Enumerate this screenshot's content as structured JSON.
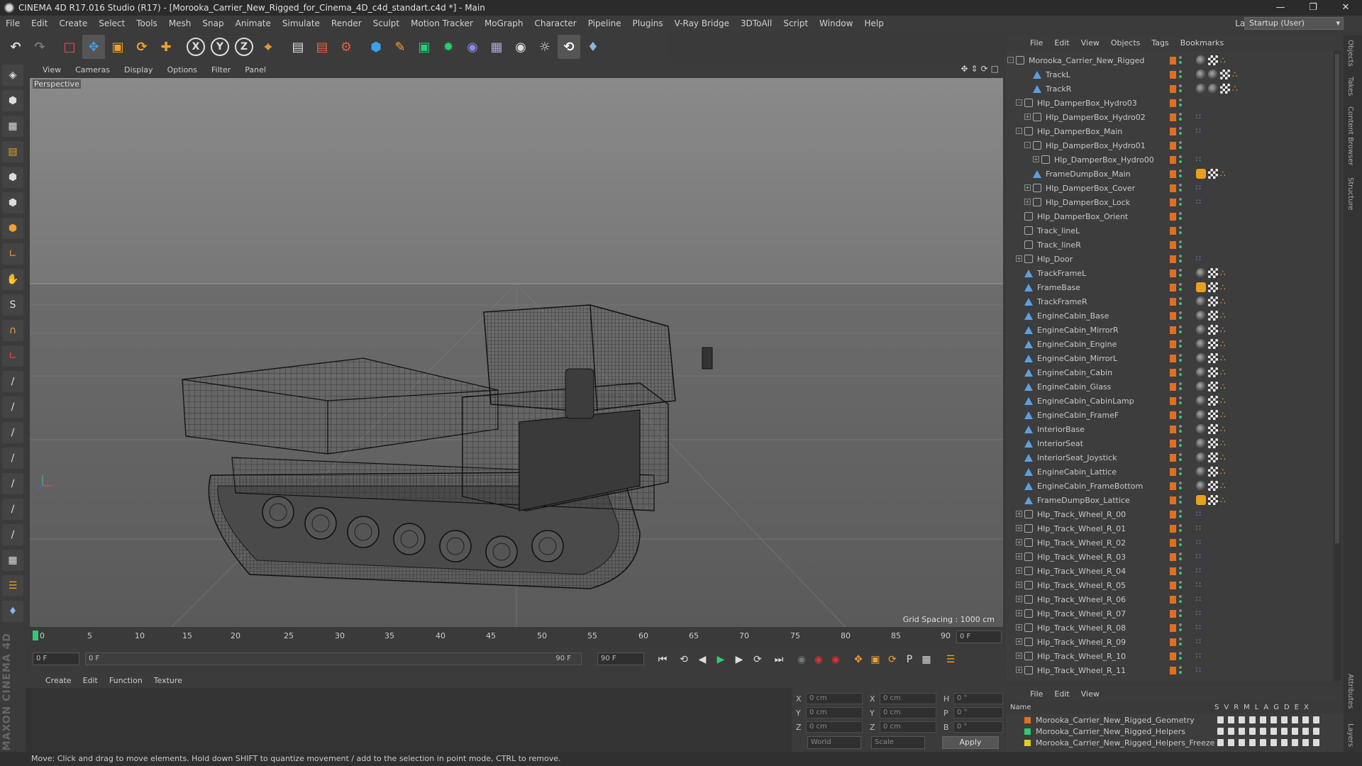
{
  "window": {
    "title": "CINEMA 4D R17.016 Studio (R17) - [Morooka_Carrier_New_Rigged_for_Cinema_4D_c4d_standart.c4d *] - Main"
  },
  "menubar": {
    "items": [
      "File",
      "Edit",
      "Create",
      "Select",
      "Tools",
      "Mesh",
      "Snap",
      "Animate",
      "Simulate",
      "Render",
      "Sculpt",
      "Motion Tracker",
      "MoGraph",
      "Character",
      "Pipeline",
      "Plugins",
      "V-Ray Bridge",
      "3DToAll",
      "Script",
      "Window",
      "Help"
    ],
    "layout_label": "Layout:",
    "layout_value": "Startup (User)"
  },
  "viewport": {
    "menu": [
      "View",
      "Cameras",
      "Display",
      "Options",
      "Filter",
      "Panel"
    ],
    "label": "Perspective",
    "grid_spacing": "Grid Spacing : 1000 cm"
  },
  "timeline": {
    "ticks": [
      "0",
      "5",
      "10",
      "15",
      "20",
      "25",
      "30",
      "35",
      "40",
      "45",
      "50",
      "55",
      "60",
      "65",
      "70",
      "75",
      "80",
      "85",
      "90"
    ],
    "current_frame_field": "0 F",
    "start_field": "0 F",
    "range_start": "0 F",
    "range_end": "90 F",
    "end_field": "90 F"
  },
  "material_manager": {
    "menu": [
      "Create",
      "Edit",
      "Function",
      "Texture"
    ]
  },
  "coordinates": {
    "rows": [
      {
        "l1": "X",
        "v1": "0 cm",
        "l2": "X",
        "v2": "0 cm",
        "l3": "H",
        "v3": "0 °"
      },
      {
        "l1": "Y",
        "v1": "0 cm",
        "l2": "Y",
        "v2": "0 cm",
        "l3": "P",
        "v3": "0 °"
      },
      {
        "l1": "Z",
        "v1": "0 cm",
        "l2": "Z",
        "v2": "0 cm",
        "l3": "B",
        "v3": "0 °"
      }
    ],
    "world": "World",
    "scale": "Scale",
    "apply": "Apply"
  },
  "object_manager": {
    "menu": [
      "File",
      "Edit",
      "View",
      "Objects",
      "Tags",
      "Bookmarks"
    ],
    "objects": [
      {
        "name": "Morooka_Carrier_New_Rigged",
        "indent": 0,
        "icon": "null",
        "expander": "-",
        "tags": [
          "mat",
          "check",
          "dots"
        ]
      },
      {
        "name": "TrackL",
        "indent": 2,
        "icon": "poly",
        "expander": "",
        "tags": [
          "mat",
          "mat",
          "check",
          "dots"
        ]
      },
      {
        "name": "TrackR",
        "indent": 2,
        "icon": "poly",
        "expander": "",
        "tags": [
          "mat",
          "mat",
          "check",
          "dots"
        ]
      },
      {
        "name": "Hlp_DamperBox_Hydro03",
        "indent": 1,
        "icon": "null",
        "expander": "-",
        "tags": []
      },
      {
        "name": "Hlp_DamperBox_Hydro02",
        "indent": 2,
        "icon": "null",
        "expander": "+",
        "tags": [
          "dash"
        ]
      },
      {
        "name": "Hlp_DamperBox_Main",
        "indent": 1,
        "icon": "null",
        "expander": "-",
        "tags": [
          "dash"
        ]
      },
      {
        "name": "Hlp_DamperBox_Hydro01",
        "indent": 2,
        "icon": "null",
        "expander": "-",
        "tags": []
      },
      {
        "name": "Hlp_DamperBox_Hydro00",
        "indent": 3,
        "icon": "null",
        "expander": "+",
        "tags": [
          "dash"
        ]
      },
      {
        "name": "FrameDumpBox_Main",
        "indent": 2,
        "icon": "poly",
        "expander": "",
        "tags": [
          "anchor",
          "check",
          "dots"
        ]
      },
      {
        "name": "Hlp_DamperBox_Cover",
        "indent": 2,
        "icon": "null",
        "expander": "+",
        "tags": [
          "dash"
        ]
      },
      {
        "name": "Hlp_DamperBox_Lock",
        "indent": 2,
        "icon": "null",
        "expander": "+",
        "tags": [
          "dash"
        ]
      },
      {
        "name": "Hlp_DamperBox_Orient",
        "indent": 1,
        "icon": "null",
        "expander": "",
        "tags": []
      },
      {
        "name": "Track_lineL",
        "indent": 1,
        "icon": "null",
        "expander": "",
        "tags": []
      },
      {
        "name": "Track_lineR",
        "indent": 1,
        "icon": "null",
        "expander": "",
        "tags": []
      },
      {
        "name": "Hlp_Door",
        "indent": 1,
        "icon": "null",
        "expander": "+",
        "tags": [
          "dash"
        ]
      },
      {
        "name": "TrackFrameL",
        "indent": 1,
        "icon": "poly",
        "expander": "",
        "tags": [
          "mat",
          "check",
          "dots"
        ]
      },
      {
        "name": "FrameBase",
        "indent": 1,
        "icon": "poly",
        "expander": "",
        "tags": [
          "anchor",
          "check",
          "dots"
        ]
      },
      {
        "name": "TrackFrameR",
        "indent": 1,
        "icon": "poly",
        "expander": "",
        "tags": [
          "mat",
          "check",
          "dots"
        ]
      },
      {
        "name": "EngineCabin_Base",
        "indent": 1,
        "icon": "poly",
        "expander": "",
        "tags": [
          "mat",
          "check",
          "dots"
        ]
      },
      {
        "name": "EngineCabin_MirrorR",
        "indent": 1,
        "icon": "poly",
        "expander": "",
        "tags": [
          "mat",
          "check",
          "dots"
        ]
      },
      {
        "name": "EngineCabin_Engine",
        "indent": 1,
        "icon": "poly",
        "expander": "",
        "tags": [
          "mat",
          "check",
          "dots"
        ]
      },
      {
        "name": "EngineCabin_MirrorL",
        "indent": 1,
        "icon": "poly",
        "expander": "",
        "tags": [
          "mat",
          "check",
          "dots"
        ]
      },
      {
        "name": "EngineCabin_Cabin",
        "indent": 1,
        "icon": "poly",
        "expander": "",
        "tags": [
          "mat",
          "check",
          "dots"
        ]
      },
      {
        "name": "EngineCabin_Glass",
        "indent": 1,
        "icon": "poly",
        "expander": "",
        "tags": [
          "mat",
          "check",
          "dots"
        ]
      },
      {
        "name": "EngineCabin_CabinLamp",
        "indent": 1,
        "icon": "poly",
        "expander": "",
        "tags": [
          "mat",
          "check",
          "dots"
        ]
      },
      {
        "name": "EngineCabin_FrameF",
        "indent": 1,
        "icon": "poly",
        "expander": "",
        "tags": [
          "mat",
          "check",
          "dots"
        ]
      },
      {
        "name": "InteriorBase",
        "indent": 1,
        "icon": "poly",
        "expander": "",
        "tags": [
          "mat",
          "check",
          "dots"
        ]
      },
      {
        "name": "InteriorSeat",
        "indent": 1,
        "icon": "poly",
        "expander": "",
        "tags": [
          "mat",
          "check",
          "dots"
        ]
      },
      {
        "name": "InteriorSeat_Joystick",
        "indent": 1,
        "icon": "poly",
        "expander": "",
        "tags": [
          "mat",
          "check",
          "dots"
        ]
      },
      {
        "name": "EngineCabin_Lattice",
        "indent": 1,
        "icon": "poly",
        "expander": "",
        "tags": [
          "mat",
          "check",
          "dots"
        ]
      },
      {
        "name": "EngineCabin_FrameBottom",
        "indent": 1,
        "icon": "poly",
        "expander": "",
        "tags": [
          "mat",
          "check",
          "dots"
        ]
      },
      {
        "name": "FrameDumpBox_Lattice",
        "indent": 1,
        "icon": "poly",
        "expander": "",
        "tags": [
          "anchor",
          "check",
          "dots"
        ]
      },
      {
        "name": "Hlp_Track_Wheel_R_00",
        "indent": 1,
        "icon": "null",
        "expander": "+",
        "tags": [
          "dash"
        ]
      },
      {
        "name": "Hlp_Track_Wheel_R_01",
        "indent": 1,
        "icon": "null",
        "expander": "+",
        "tags": [
          "dash"
        ]
      },
      {
        "name": "Hlp_Track_Wheel_R_02",
        "indent": 1,
        "icon": "null",
        "expander": "+",
        "tags": [
          "dash"
        ]
      },
      {
        "name": "Hlp_Track_Wheel_R_03",
        "indent": 1,
        "icon": "null",
        "expander": "+",
        "tags": [
          "dash"
        ]
      },
      {
        "name": "Hlp_Track_Wheel_R_04",
        "indent": 1,
        "icon": "null",
        "expander": "+",
        "tags": [
          "dash"
        ]
      },
      {
        "name": "Hlp_Track_Wheel_R_05",
        "indent": 1,
        "icon": "null",
        "expander": "+",
        "tags": [
          "dash"
        ]
      },
      {
        "name": "Hlp_Track_Wheel_R_06",
        "indent": 1,
        "icon": "null",
        "expander": "+",
        "tags": [
          "dash"
        ]
      },
      {
        "name": "Hlp_Track_Wheel_R_07",
        "indent": 1,
        "icon": "null",
        "expander": "+",
        "tags": [
          "dash"
        ]
      },
      {
        "name": "Hlp_Track_Wheel_R_08",
        "indent": 1,
        "icon": "null",
        "expander": "+",
        "tags": [
          "dash"
        ]
      },
      {
        "name": "Hlp_Track_Wheel_R_09",
        "indent": 1,
        "icon": "null",
        "expander": "+",
        "tags": [
          "dash"
        ]
      },
      {
        "name": "Hlp_Track_Wheel_R_10",
        "indent": 1,
        "icon": "null",
        "expander": "+",
        "tags": [
          "dash"
        ]
      },
      {
        "name": "Hlp_Track_Wheel_R_11",
        "indent": 1,
        "icon": "null",
        "expander": "+",
        "tags": [
          "dash"
        ]
      }
    ]
  },
  "side_tabs": [
    "Objects",
    "Takes",
    "Content Browser",
    "Structure",
    "Attributes",
    "Layers"
  ],
  "layer_manager": {
    "menu": [
      "File",
      "Edit",
      "View"
    ],
    "header_name": "Name",
    "header_cols": [
      "S",
      "V",
      "R",
      "M",
      "L",
      "A",
      "G",
      "D",
      "E",
      "X"
    ],
    "layers": [
      {
        "name": "Morooka_Carrier_New_Rigged_Geometry",
        "color": "#e07020"
      },
      {
        "name": "Morooka_Carrier_New_Rigged_Helpers",
        "color": "#2ecc71"
      },
      {
        "name": "Morooka_Carrier_New_Rigged_Helpers_Freeze",
        "color": "#e0d020"
      }
    ]
  },
  "statusbar": {
    "text": "Move: Click and drag to move elements. Hold down SHIFT to quantize movement / add to the selection in point mode, CTRL to remove."
  },
  "colors": {
    "accent_orange": "#f0a030",
    "timeline_marker": "#2ecc71",
    "axis_blue": "#3aa0e8"
  }
}
